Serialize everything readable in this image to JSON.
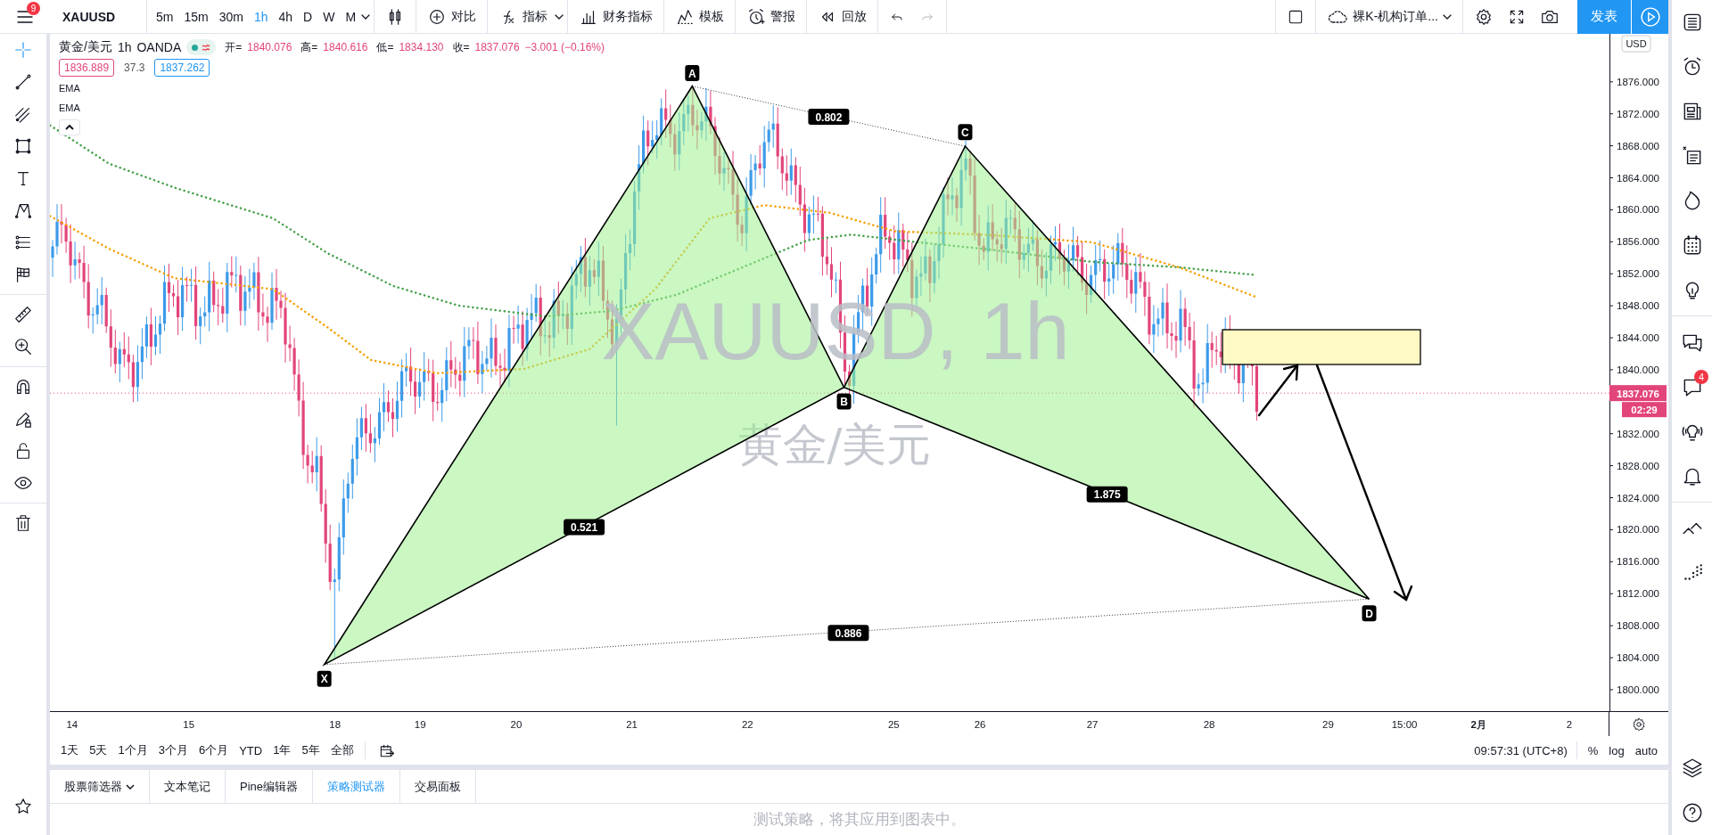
{
  "top_toolbar": {
    "menu_badge": "9",
    "symbol": "XAUUSD",
    "intervals": [
      {
        "label": "5m",
        "selected": false
      },
      {
        "label": "15m",
        "selected": false
      },
      {
        "label": "30m",
        "selected": false
      },
      {
        "label": "1h",
        "selected": true
      },
      {
        "label": "4h",
        "selected": false
      },
      {
        "label": "D",
        "selected": false
      },
      {
        "label": "W",
        "selected": false
      },
      {
        "label": "M",
        "selected": false
      }
    ],
    "tools": [
      {
        "kind": "compare",
        "label": "对比"
      },
      {
        "kind": "indicators",
        "label": "指标"
      },
      {
        "kind": "financials",
        "label": "财务指标"
      },
      {
        "kind": "templates",
        "label": "模板"
      },
      {
        "kind": "alert",
        "label": "警报"
      },
      {
        "kind": "replay",
        "label": "回放"
      }
    ],
    "layout_name": "裸K-机构订单...",
    "publish_label": "发表"
  },
  "legend": {
    "name": "黄金/美元",
    "interval": "1h",
    "exchange": "OANDA",
    "ohlc": [
      {
        "label": "开=",
        "value": "1840.076"
      },
      {
        "label": "高=",
        "value": "1840.616"
      },
      {
        "label": "低=",
        "value": "1834.130"
      },
      {
        "label": "收=",
        "value": "1837.076"
      }
    ],
    "change": "−3.001 (−0.16%)",
    "quotes": [
      {
        "kind": "bid",
        "text": "1836.889"
      },
      {
        "kind": "spread",
        "text": "37.3"
      },
      {
        "kind": "ask",
        "text": "1837.262"
      }
    ],
    "indicators": [
      "EMA",
      "EMA"
    ]
  },
  "chart": {
    "watermark_symbol": "XAUUSD, 1h",
    "watermark_name": "黄金/美元",
    "pattern_points": [
      "X",
      "A",
      "B",
      "C",
      "D"
    ],
    "ratios": [
      "0.802",
      "0.521",
      "1.875",
      "0.886"
    ]
  },
  "price_axis": {
    "currency": "USD",
    "labels_upper": [
      "1876.000",
      "1872.000",
      "1868.000",
      "1864.000",
      "1860.000",
      "1856.000",
      "1852.000",
      "1848.000",
      "1844.000",
      "1840.000"
    ],
    "labels_lower": [
      "1832.000",
      "1828.000",
      "1824.000",
      "1820.000",
      "1816.000",
      "1812.000",
      "1808.000",
      "1804.000",
      "1800.000"
    ],
    "last_price": "1837.076",
    "countdown": "02:29"
  },
  "time_axis": {
    "labels": [
      {
        "text": "14",
        "kind": "day"
      },
      {
        "text": "15",
        "kind": "day"
      },
      {
        "text": "18",
        "kind": "day"
      },
      {
        "text": "19",
        "kind": "day"
      },
      {
        "text": "20",
        "kind": "day"
      },
      {
        "text": "21",
        "kind": "day"
      },
      {
        "text": "22",
        "kind": "day"
      },
      {
        "text": "25",
        "kind": "day"
      },
      {
        "text": "26",
        "kind": "day"
      },
      {
        "text": "27",
        "kind": "day"
      },
      {
        "text": "28",
        "kind": "day"
      },
      {
        "text": "29",
        "kind": "day"
      },
      {
        "text": "15:00",
        "kind": "time"
      },
      {
        "text": "2月",
        "kind": "month"
      },
      {
        "text": "2",
        "kind": "day"
      }
    ]
  },
  "range_bar": {
    "ranges": [
      "1天",
      "5天",
      "1个月",
      "3个月",
      "6个月",
      "YTD",
      "1年",
      "5年",
      "全部"
    ],
    "clock": "09:57:31 (UTC+8)",
    "scale_options": [
      "%",
      "log",
      "auto"
    ]
  },
  "bottom_panel": {
    "tabs": [
      {
        "label": "股票筛选器",
        "selected": false,
        "has_menu": true
      },
      {
        "label": "文本笔记",
        "selected": false,
        "has_menu": false
      },
      {
        "label": "Pine编辑器",
        "selected": false,
        "has_menu": false
      },
      {
        "label": "策略测试器",
        "selected": true,
        "has_menu": false
      },
      {
        "label": "交易面板",
        "selected": false,
        "has_menu": false
      }
    ],
    "message": "测试策略，将其应用到图表中。"
  },
  "right_sidebar": {
    "chat_badge": "4"
  }
}
